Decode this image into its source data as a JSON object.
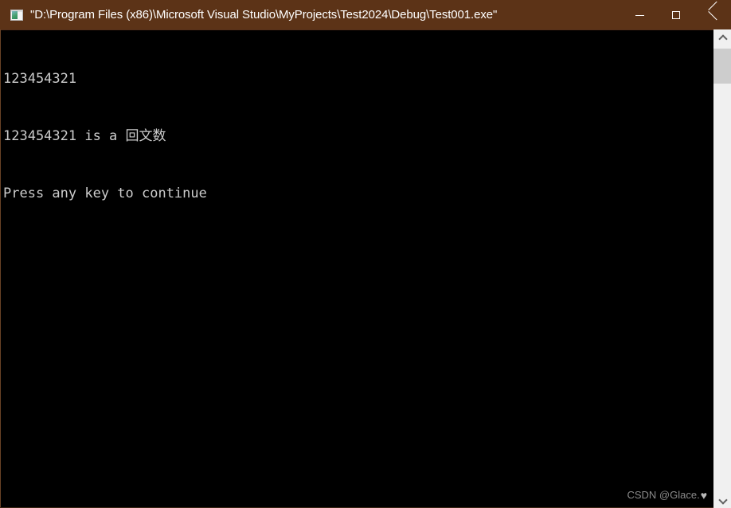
{
  "window": {
    "title": "\"D:\\Program Files (x86)\\Microsoft Visual Studio\\MyProjects\\Test2024\\Debug\\Test001.exe\"",
    "icon_name": "console-app-icon",
    "titlebar_color": "#5C3317",
    "background_color": "#000000"
  },
  "controls": {
    "minimize_label": "─",
    "maximize_label": "□",
    "close_label": "✕"
  },
  "console": {
    "text_color": "#CCCCCC",
    "lines": [
      "123454321",
      "123454321 is a 回文数",
      "Press any key to continue"
    ]
  },
  "scrollbar": {
    "up_arrow": "⌃",
    "down_arrow": "⌄",
    "track_color": "#F0F0F0",
    "thumb_color": "#CDCDCD"
  },
  "watermark": {
    "text": "CSDN @Glace.",
    "heart": "♥"
  }
}
